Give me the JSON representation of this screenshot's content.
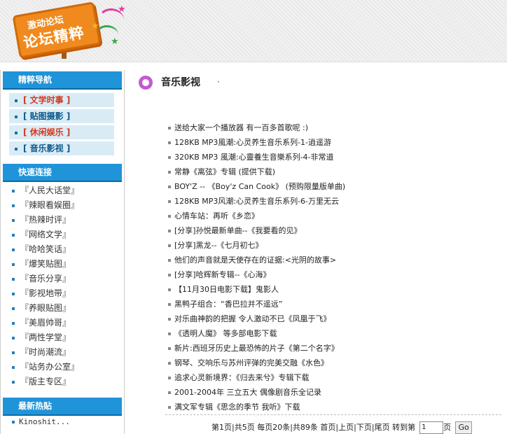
{
  "header": {
    "logo_small": "激动论坛",
    "logo_big": "论坛精粹"
  },
  "sidebar": {
    "nav_title": "精粹导航",
    "nav_items": [
      {
        "label": "[ 文学时事 ]",
        "color": "red"
      },
      {
        "label": "[ 贴图摄影 ]",
        "color": "blue"
      },
      {
        "label": "[ 休闲娱乐 ]",
        "color": "red"
      },
      {
        "label": "[ 音乐影视 ]",
        "color": "blue"
      }
    ],
    "quick_title": "快速连接",
    "quick_links": [
      "『人民大话堂』",
      "『辣眼看娱圈』",
      "『热辣时评』",
      "『网络文学』",
      "『哈哈笑话』",
      "『爆笑贴图』",
      "『音乐分享』",
      "『影视地带』",
      "『养眼贴图』",
      "『美眉帅哥』",
      "『两性学堂』",
      "『时尚潮流』",
      "『站务办公室』",
      "『版主专区』"
    ],
    "hot_title": "最新热贴",
    "hot_items": [
      "Kinoshit..."
    ]
  },
  "main": {
    "section_title": "音乐影视",
    "section_dot": "·",
    "topics": [
      "送给大家一个播放器 有一百多首歌呢 :)",
      "128KB MP3風潮:心灵养生音乐系列-1-逍遥游",
      "320KB MP3 風潮:心靈養生音樂系列-4-非常道",
      "常静《离弦》专辑 (提供下载)",
      "BOY'Z -- 《Boy'z Can Cook》 (预购限量版单曲)",
      "128KB MP3风潮:心灵养生音乐系列-6-万里无云",
      "心情车站：再听《乡恋》",
      "[分享]孙悦最新单曲--《我要看的见》",
      "[分享]黑龙--《七月初七》",
      "他们的声音就是天使存在的证据:<光阴的故事>",
      "[分享]哈辉新专辑--《心海》",
      "【11月30日电影下载】鬼影人",
      "黑鸭子组合：“香巴拉并不遥远”",
      "对乐曲神韵的把握 令人激动不已《凤凰于飞》",
      "《透明人魔》  等多部电影下载",
      "新片:西班牙历史上最恐怖的片子《第二个名字》",
      "钢琴、交响乐与苏州评弹的完美交融《水色》",
      "追求心灵新境界：《归去来兮》专辑下载",
      "2001-2004年 三立五大 偶像剧音乐全记录",
      "满文军专辑《思念的季节 我听》下载"
    ],
    "pager": {
      "current": "第1页",
      "total_pages": "|共5页",
      "per_page": "每页20条",
      "total_items": "|共89条",
      "first": "首页",
      "prev": "|上页",
      "next": "|下页",
      "last": "|尾页",
      "goto_label": "转到第",
      "goto_value": "1",
      "goto_suffix": "页",
      "go_button": "Go"
    }
  }
}
